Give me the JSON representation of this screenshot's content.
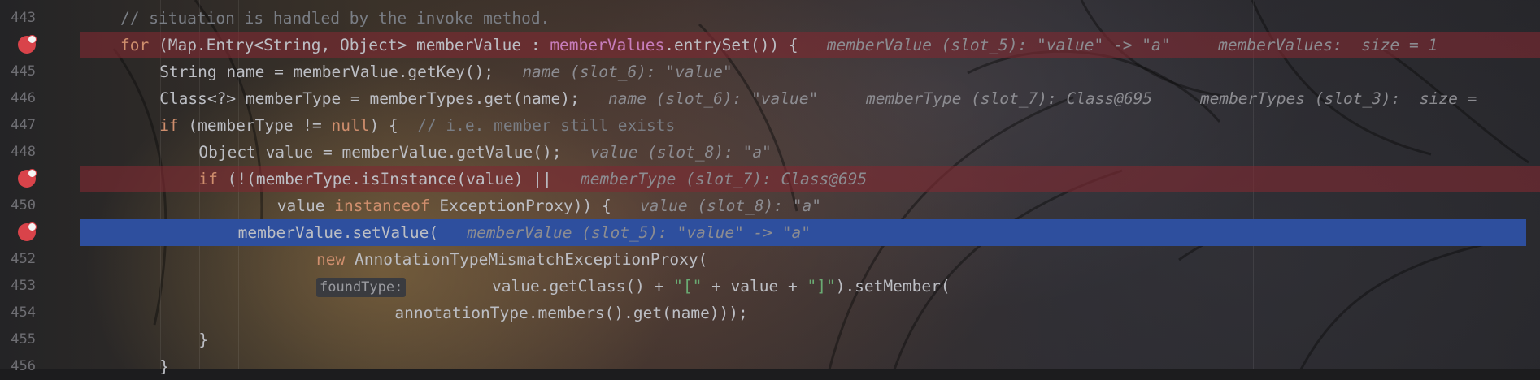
{
  "editor": {
    "lines": [
      {
        "num": "443",
        "bp": false,
        "current": false,
        "indent": 2,
        "tokens": [
          {
            "t": "cm",
            "v": "// situation is handled by the invoke method."
          }
        ]
      },
      {
        "num": "",
        "bp": true,
        "current": false,
        "indent": 2,
        "tokens": [
          {
            "t": "kw",
            "v": "for "
          },
          {
            "t": "tx",
            "v": "(Map.Entry<String, Object> memberValue : "
          },
          {
            "t": "fld",
            "v": "memberValues"
          },
          {
            "t": "tx",
            "v": ".entrySet()) {"
          },
          {
            "t": "hint",
            "v": "   memberValue (slot_5): \"value\" -> \"a\"     memberValues:  size = 1"
          }
        ]
      },
      {
        "num": "445",
        "bp": false,
        "current": false,
        "indent": 3,
        "tokens": [
          {
            "t": "tx",
            "v": "String name = memberValue.getKey();"
          },
          {
            "t": "hint",
            "v": "   name (slot_6): \"value\""
          }
        ]
      },
      {
        "num": "446",
        "bp": false,
        "current": false,
        "indent": 3,
        "tokens": [
          {
            "t": "tx",
            "v": "Class<?> memberType = memberTypes.get(name);"
          },
          {
            "t": "hint",
            "v": "   name (slot_6): \"value\"     memberType (slot_7): Class@695     memberTypes (slot_3):  size ="
          }
        ]
      },
      {
        "num": "447",
        "bp": false,
        "current": false,
        "indent": 3,
        "tokens": [
          {
            "t": "kw",
            "v": "if "
          },
          {
            "t": "tx",
            "v": "(memberType != "
          },
          {
            "t": "kw",
            "v": "null"
          },
          {
            "t": "tx",
            "v": ") {  "
          },
          {
            "t": "cm",
            "v": "// i.e. member still exists"
          }
        ]
      },
      {
        "num": "448",
        "bp": false,
        "current": false,
        "indent": 4,
        "tokens": [
          {
            "t": "tx",
            "v": "Object value = memberValue.getValue();"
          },
          {
            "t": "hint",
            "v": "   value (slot_8): \"a\""
          }
        ]
      },
      {
        "num": "",
        "bp": true,
        "current": false,
        "indent": 4,
        "tokens": [
          {
            "t": "kw",
            "v": "if "
          },
          {
            "t": "tx",
            "v": "(!(memberType.isInstance(value) ||"
          },
          {
            "t": "hint",
            "v": "   memberType (slot_7): Class@695"
          }
        ]
      },
      {
        "num": "450",
        "bp": false,
        "current": false,
        "indent": 6,
        "tokens": [
          {
            "t": "tx",
            "v": "value "
          },
          {
            "t": "kw",
            "v": "instanceof "
          },
          {
            "t": "tx",
            "v": "ExceptionProxy)) {"
          },
          {
            "t": "hint",
            "v": "   value (slot_8): \"a\""
          }
        ]
      },
      {
        "num": "",
        "bp": true,
        "current": true,
        "indent": 5,
        "tokens": [
          {
            "t": "tx",
            "v": "memberValue.setValue("
          },
          {
            "t": "hint",
            "v": "   memberValue (slot_5): \"value\" -> \"a\""
          }
        ]
      },
      {
        "num": "452",
        "bp": false,
        "current": false,
        "indent": 7,
        "tokens": [
          {
            "t": "kw",
            "v": "new "
          },
          {
            "t": "tx",
            "v": "AnnotationTypeMismatchExceptionProxy("
          }
        ]
      },
      {
        "num": "453",
        "bp": false,
        "current": false,
        "indent": 7,
        "tokens": [
          {
            "t": "tag",
            "v": "foundType:"
          },
          {
            "t": "tx",
            "v": "         value.getClass() + "
          },
          {
            "t": "str",
            "v": "\"[\""
          },
          {
            "t": "tx",
            "v": " + value + "
          },
          {
            "t": "str",
            "v": "\"]\""
          },
          {
            "t": "tx",
            "v": ").setMember("
          }
        ]
      },
      {
        "num": "454",
        "bp": false,
        "current": false,
        "indent": 9,
        "tokens": [
          {
            "t": "tx",
            "v": "annotationType.members().get(name)));"
          }
        ]
      },
      {
        "num": "455",
        "bp": false,
        "current": false,
        "indent": 4,
        "tokens": [
          {
            "t": "tx",
            "v": "}"
          }
        ]
      },
      {
        "num": "456",
        "bp": false,
        "current": false,
        "indent": 3,
        "tokens": [
          {
            "t": "tx",
            "v": "}"
          }
        ]
      }
    ]
  }
}
